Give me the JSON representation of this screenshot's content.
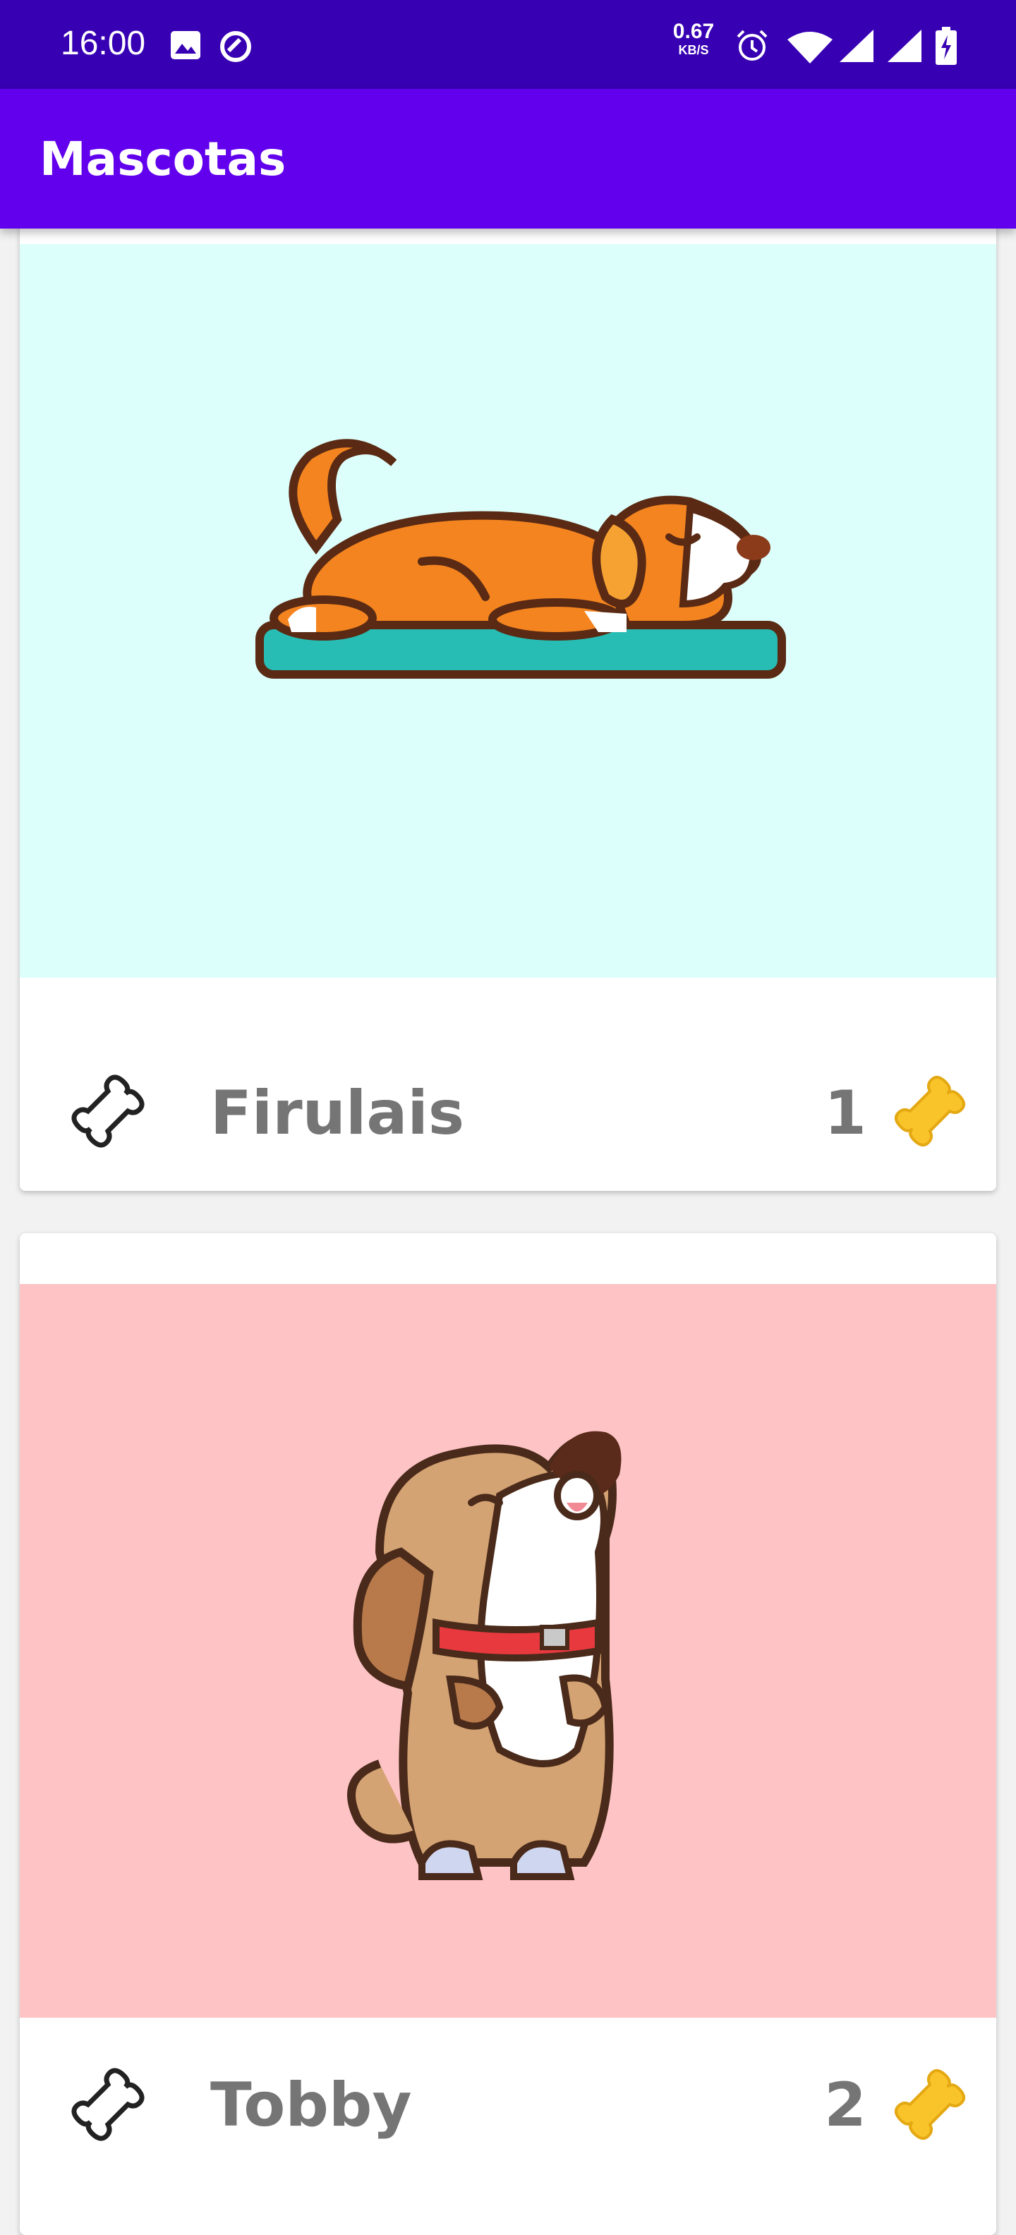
{
  "status_bar": {
    "time": "16:00",
    "speed_value": "0.67",
    "speed_unit": "KB/S",
    "icons": [
      "image-icon",
      "sync-icon",
      "alarm-icon",
      "wifi-icon",
      "signal-icon",
      "signal-icon",
      "battery-charging-icon"
    ]
  },
  "app_bar": {
    "title": "Mascotas"
  },
  "pets": [
    {
      "name": "Firulais",
      "rating": "1",
      "bg": "#ddfffb"
    },
    {
      "name": "Tobby",
      "rating": "2",
      "bg": "#fec3c5"
    }
  ],
  "colors": {
    "status_bar": "#3700b3",
    "app_bar": "#6200ee",
    "gold_bone": "#f9c42a"
  }
}
